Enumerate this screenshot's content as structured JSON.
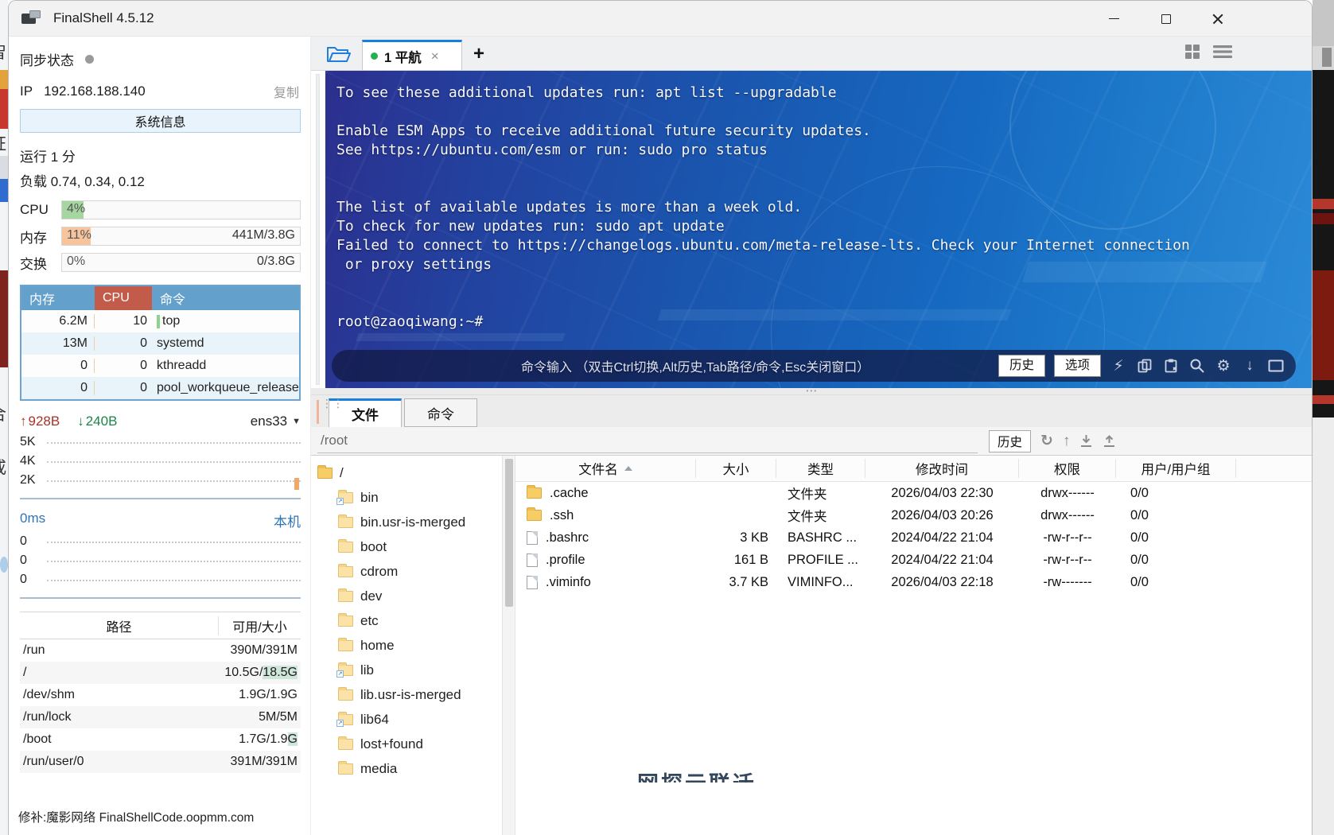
{
  "colors": {
    "accent_blue": "#1a7ee0",
    "tab_green": "#23b14d",
    "proc_header_blue": "#64a0cc",
    "proc_cpu_red": "#c25b49",
    "net_up_red": "#a93226",
    "net_down_green": "#1e8449",
    "highlight_green": "#cfe6da",
    "bolt_green": "#35d435"
  },
  "edges": {
    "left_glyphs": [
      "智",
      "证",
      "合",
      "戒"
    ]
  },
  "window": {
    "title": "FinalShell 4.5.12"
  },
  "icons": {
    "dropdown": "▼",
    "up_arrow": "↑",
    "down_arrow": "↓",
    "lightning": "⚡",
    "refresh": "↻",
    "parent_dir": "↑",
    "gear": "⚙",
    "dots_h": "⋯",
    "dots_v": "⋮⋮",
    "link_badge": "↗"
  },
  "sidebar": {
    "sync_label": "同步状态",
    "ip_label": "IP",
    "ip_value": "192.168.188.140",
    "copy_label": "复制",
    "sysinfo_button": "系统信息",
    "uptime": "运行 1 分",
    "load": "负载 0.74, 0.34, 0.12",
    "meters": [
      {
        "label": "CPU",
        "percent": "4%",
        "detail": "",
        "fill": 9,
        "color": "#a6d6a0"
      },
      {
        "label": "内存",
        "percent": "11%",
        "detail": "441M/3.8G",
        "fill": 12,
        "color": "#f6c49d"
      },
      {
        "label": "交换",
        "percent": "0%",
        "detail": "0/3.8G",
        "fill": 0,
        "color": "#a6d6a0"
      }
    ],
    "process_table": {
      "headers": [
        "内存",
        "CPU",
        "命令"
      ],
      "rows": [
        [
          "6.2M",
          "10",
          "top"
        ],
        [
          "13M",
          "0",
          "systemd"
        ],
        [
          "0",
          "0",
          "kthreadd"
        ],
        [
          "0",
          "0",
          "pool_workqueue_release"
        ]
      ]
    },
    "network": {
      "up": "928B",
      "down": "240B",
      "iface": "ens33",
      "ticks": [
        "5K",
        "4K",
        "2K"
      ]
    },
    "ping": {
      "latency": "0ms",
      "target": "本机",
      "ticks": [
        "0",
        "0",
        "0"
      ]
    },
    "disk_table": {
      "headers": [
        "路径",
        "可用/大小"
      ],
      "rows": [
        {
          "path": "/run",
          "avail": "390M/391M",
          "hl": ""
        },
        {
          "path": "/",
          "avail": "10.5G/",
          "hl": "18.5G"
        },
        {
          "path": "/dev/shm",
          "avail": "1.9G/1.9G",
          "hl": ""
        },
        {
          "path": "/run/lock",
          "avail": "5M/5M",
          "hl": ""
        },
        {
          "path": "/boot",
          "avail": "1.7G/1.9",
          "hl": "G"
        },
        {
          "path": "/run/user/0",
          "avail": "391M/391M",
          "hl": ""
        }
      ]
    },
    "footer": "修补:魔影网络 FinalShellCode.oopmm.com"
  },
  "tabbar": {
    "tab_label": "1 平航",
    "close": "×",
    "add": "+"
  },
  "terminal": {
    "lines": [
      "To see these additional updates run: apt list --upgradable",
      "",
      "Enable ESM Apps to receive additional future security updates.",
      "See https://ubuntu.com/esm or run: sudo pro status",
      "",
      "",
      "The list of available updates is more than a week old.",
      "To check for new updates run: sudo apt update",
      "Failed to connect to https://changelogs.ubuntu.com/meta-release-lts. Check your Internet connection",
      " or proxy settings",
      "",
      "",
      "root@zaoqiwang:~#"
    ]
  },
  "command_bar": {
    "hint": "命令输入 （双击Ctrl切换,Alt历史,Tab路径/命令,Esc关闭窗口）",
    "history_button": "历史",
    "options_button": "选项"
  },
  "bottom": {
    "tabs": [
      {
        "label": "文件"
      },
      {
        "label": "命令"
      }
    ],
    "path_value": "/root",
    "history_button": "历史",
    "tree": {
      "root": "/",
      "items": [
        {
          "name": "bin",
          "link": true
        },
        {
          "name": "bin.usr-is-merged",
          "link": false
        },
        {
          "name": "boot",
          "link": false
        },
        {
          "name": "cdrom",
          "link": false
        },
        {
          "name": "dev",
          "link": false
        },
        {
          "name": "etc",
          "link": false
        },
        {
          "name": "home",
          "link": false
        },
        {
          "name": "lib",
          "link": true
        },
        {
          "name": "lib.usr-is-merged",
          "link": false
        },
        {
          "name": "lib64",
          "link": true
        },
        {
          "name": "lost+found",
          "link": false
        },
        {
          "name": "media",
          "link": false
        }
      ]
    },
    "file_table": {
      "headers": [
        "文件名",
        "大小",
        "类型",
        "修改时间",
        "权限",
        "用户/用户组"
      ],
      "rows": [
        {
          "name": ".cache",
          "icon": "folder",
          "size": "",
          "type": "文件夹",
          "mtime": "2026/04/03 22:30",
          "perm": "drwx------",
          "owner": "0/0"
        },
        {
          "name": ".ssh",
          "icon": "folder",
          "size": "",
          "type": "文件夹",
          "mtime": "2026/04/03 20:26",
          "perm": "drwx------",
          "owner": "0/0"
        },
        {
          "name": ".bashrc",
          "icon": "file",
          "size": "3 KB",
          "type": "BASHRC ...",
          "mtime": "2024/04/22 21:04",
          "perm": "-rw-r--r--",
          "owner": "0/0"
        },
        {
          "name": ".profile",
          "icon": "file",
          "size": "161 B",
          "type": "PROFILE ...",
          "mtime": "2024/04/22 21:04",
          "perm": "-rw-r--r--",
          "owner": "0/0"
        },
        {
          "name": ".viminfo",
          "icon": "file",
          "size": "3.7 KB",
          "type": "VIMINFO...",
          "mtime": "2026/04/03 22:18",
          "perm": "-rw-------",
          "owner": "0/0"
        }
      ]
    },
    "watermark": "网探云联迁"
  }
}
